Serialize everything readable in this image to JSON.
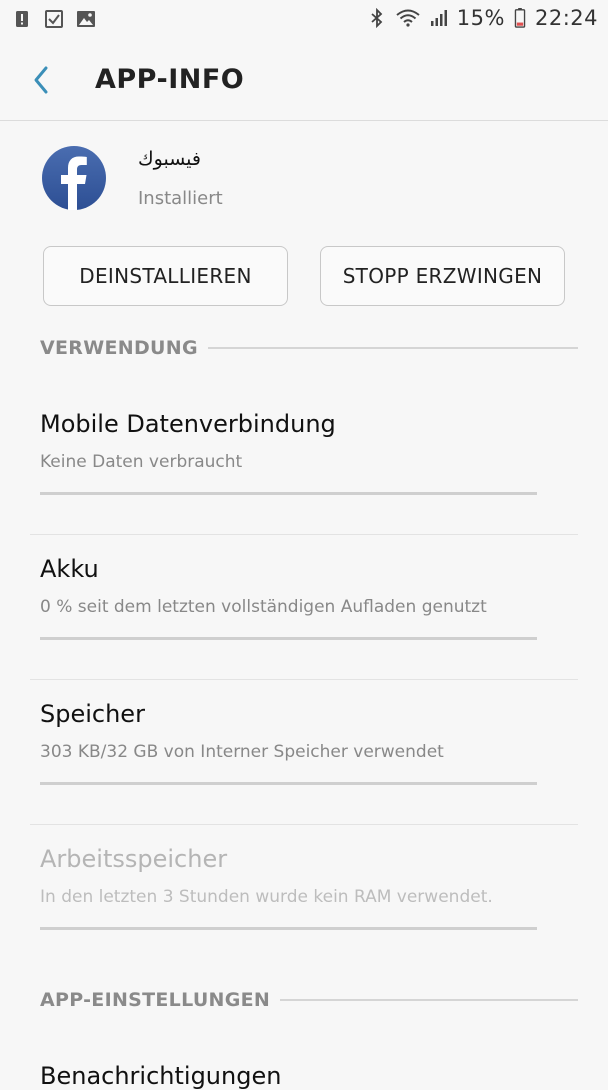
{
  "status_bar": {
    "battery": "15%",
    "time": "22:24",
    "icons_left": [
      "alert-icon",
      "checkbox-icon",
      "image-icon"
    ],
    "icons_right": [
      "bluetooth-icon",
      "wifi-icon",
      "signal-icon",
      "battery-icon"
    ]
  },
  "header": {
    "title": "APP-INFO"
  },
  "app": {
    "name": "فيسبوك",
    "status": "Installiert"
  },
  "buttons": {
    "uninstall": "DEINSTALLIEREN",
    "force_stop": "STOPP ERZWINGEN"
  },
  "sections": {
    "usage": "VERWENDUNG",
    "app_settings": "APP-EINSTELLUNGEN"
  },
  "usage_items": [
    {
      "title": "Mobile Datenverbindung",
      "subtitle": "Keine Daten verbraucht",
      "enabled": true
    },
    {
      "title": "Akku",
      "subtitle": "0 % seit dem letzten vollständigen Aufladen genutzt",
      "enabled": true
    },
    {
      "title": "Speicher",
      "subtitle": "303 KB/32 GB von Interner Speicher verwendet",
      "enabled": true
    },
    {
      "title": "Arbeitsspeicher",
      "subtitle": "In den letzten 3 Stunden wurde kein RAM verwendet.",
      "enabled": false
    }
  ],
  "next_item": {
    "title": "Benachrichtigungen"
  },
  "colors": {
    "accent": "#3b8fb8",
    "facebook_blue": "#3b5998",
    "battery_low": "#e05050"
  }
}
